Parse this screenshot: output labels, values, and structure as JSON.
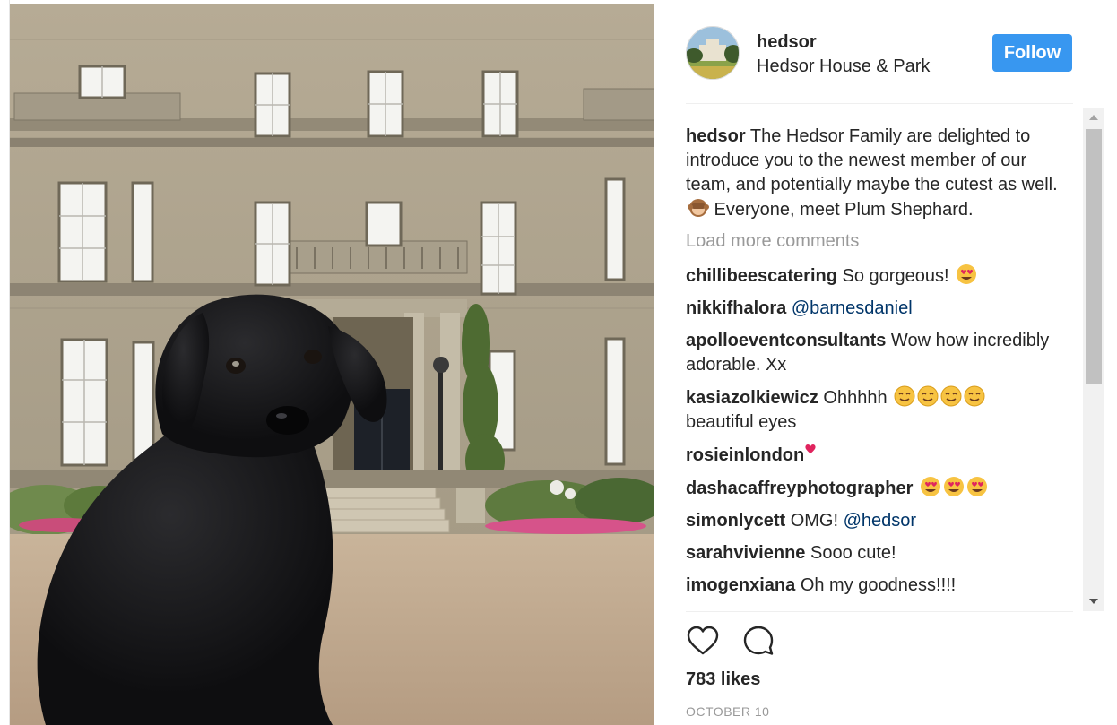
{
  "post": {
    "username": "hedsor",
    "location": "Hedsor House & Park",
    "follow_label": "Follow",
    "caption_author": "hedsor",
    "caption_text": " The Hedsor Family are delighted to introduce you to the newest member of our team, and potentially maybe the cutest as well. ",
    "caption_emoji": "see-no-evil-monkey",
    "caption_text_end": " Everyone, meet Plum Shephard.",
    "load_more_label": "Load more comments",
    "likes": "783 likes",
    "date": "OCTOBER 10"
  },
  "comments": [
    {
      "author": "chillibeescatering",
      "text": " So gorgeous! ",
      "emojis": [
        "heart-eyes"
      ]
    },
    {
      "author": "nikkifhalora",
      "text": " ",
      "mention": "@barnesdaniel"
    },
    {
      "author": "apolloeventconsultants",
      "text": " Wow how incredibly adorable. Xx"
    },
    {
      "author": "kasiazolkiewicz",
      "text": " Ohhhhh ",
      "emojis": [
        "smiling",
        "smiling",
        "smiling",
        "smiling"
      ],
      "text_after": " beautiful eyes"
    },
    {
      "author": "rosieinlondon",
      "text": "",
      "emojis": [
        "red-heart"
      ]
    },
    {
      "author": "dashacaffreyphotographer",
      "text": " ",
      "emojis": [
        "heart-eyes",
        "heart-eyes",
        "heart-eyes"
      ]
    },
    {
      "author": "simonlycett",
      "text": " OMG! ",
      "mention": "@hedsor"
    },
    {
      "author": "sarahvivienne",
      "text": " Sooo cute!"
    },
    {
      "author": "imogenxiana",
      "text": " Oh my goodness!!!!"
    }
  ],
  "icons": {
    "like": "heart-outline-icon",
    "comment": "speech-bubble-icon",
    "scroll_up": "triangle-up-icon",
    "scroll_down": "triangle-down-icon"
  },
  "colors": {
    "follow_button": "#3897f0",
    "mention": "#003569",
    "muted": "#999999"
  }
}
